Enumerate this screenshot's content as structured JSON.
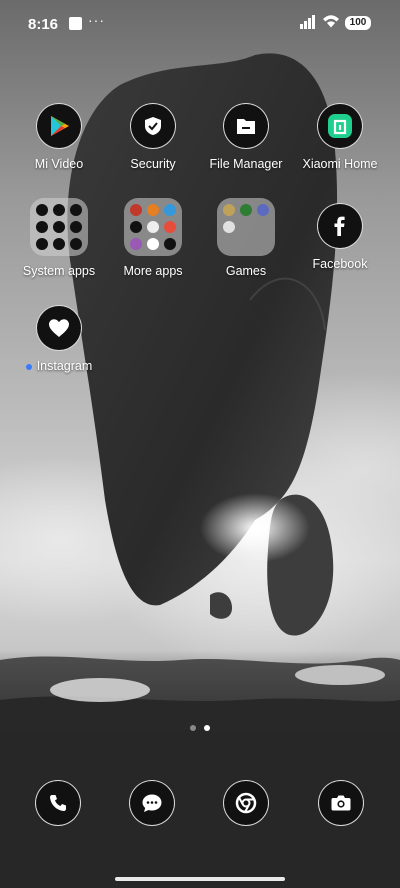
{
  "status_bar": {
    "time": "8:16",
    "overflow": "···",
    "battery": "100",
    "icons": [
      "notification-square-icon",
      "signal-icon",
      "wifi-icon",
      "battery-icon"
    ]
  },
  "apps": {
    "mi_video": "Mi Video",
    "security": "Security",
    "file_manager": "File Manager",
    "xiaomi_home": "Xiaomi Home",
    "system_apps": "System apps",
    "more_apps": "More apps",
    "games": "Games",
    "facebook": "Facebook",
    "instagram": "Instagram"
  },
  "pager": {
    "pages": 2,
    "current": 2
  },
  "dock": {
    "icons": [
      "phone-icon",
      "messages-icon",
      "chrome-icon",
      "camera-icon"
    ]
  },
  "colors": {
    "new_app_dot": "#3a7afe",
    "xiaomi_home_green": "#1fcf8e"
  }
}
